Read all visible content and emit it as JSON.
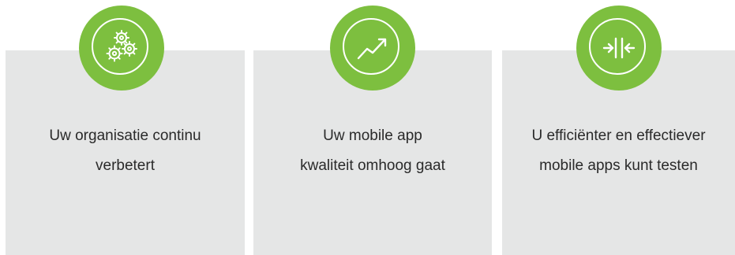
{
  "benefits": [
    {
      "icon": "gears-icon",
      "line1": "Uw organisatie continu",
      "line2": "verbetert"
    },
    {
      "icon": "trend-up-arrow-icon",
      "line1": "Uw mobile app",
      "line2": "kwaliteit omhoog gaat"
    },
    {
      "icon": "compress-arrows-icon",
      "line1": "U efficiënter en effectiever",
      "line2": "mobile apps kunt testen"
    }
  ],
  "colors": {
    "accent": "#7dbf3f",
    "card_background": "#e5e6e6",
    "text": "#2a2a2a"
  }
}
